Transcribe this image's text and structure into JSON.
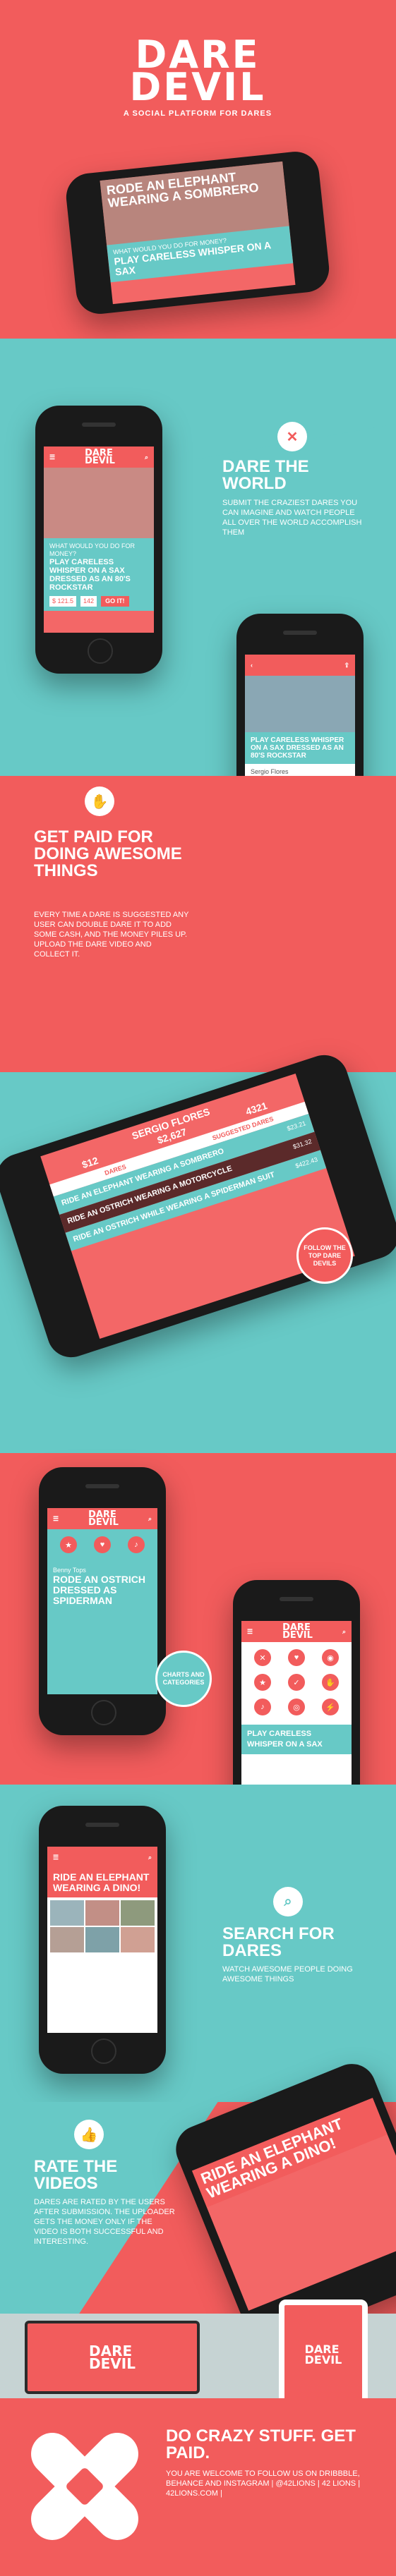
{
  "brand": {
    "logo_line1": "DARE",
    "logo_line2": "DEVIL",
    "tagline": "A SOCIAL PLATFORM FOR DARES"
  },
  "hero_phone": {
    "headline": "RODE AN ELEPHANT WEARING A SOMBRERO",
    "prompt": "WHAT WOULD YOU DO FOR MONEY?",
    "dare": "PLAY CARELESS WHISPER ON A SAX"
  },
  "feature_dare": {
    "title": "DARE THE WORLD",
    "body": "SUBMIT THE CRAZIEST DARES YOU CAN IMAGINE AND WATCH PEOPLE ALL OVER THE WORLD ACCOMPLISH THEM"
  },
  "phone_a": {
    "prompt": "WHAT WOULD YOU DO FOR MONEY?",
    "dare": "PLAY CARELESS WHISPER ON A SAX DRESSED AS AN 80'S ROCKSTAR",
    "amount": "$ 121.5",
    "count": "142",
    "go_label": "GO IT!"
  },
  "phone_b": {
    "dare": "PLAY CARELESS WHISPER ON A SAX DRESSED AS AN 80'S ROCKSTAR",
    "user": "Sergio Flores"
  },
  "feature_paid": {
    "title": "GET PAID FOR DOING AWESOME THINGS",
    "body": "EVERY TIME A DARE IS SUGGESTED ANY USER CAN DOUBLE DARE IT TO ADD SOME CASH, AND THE MONEY PILES UP. UPLOAD THE DARE VIDEO AND COLLECT IT."
  },
  "profile_phone": {
    "name": "SERGIO FLORES",
    "stat1": "$12",
    "stat2": "$2,627",
    "stat3": "4321",
    "tab1": "DARES",
    "tab2": "SUGGESTED DARES",
    "row1": "RIDE AN ELEPHANT WEARING A SOMBRERO",
    "row1_amount": "$23.21",
    "row2": "RIDE AN OSTRICH WEARING A MOTORCYCLE",
    "row2_amount": "$31.32",
    "row3": "RIDE AN OSTRICH WHILE WEARING A SPIDERMAN SUIT",
    "row3_amount": "$422.43"
  },
  "badge_follow": "FOLLOW THE TOP DARE DEVILS",
  "phone_c": {
    "user": "Benny Tops",
    "dare": "RODE AN OSTRICH DRESSED AS SPIDERMAN"
  },
  "phone_d": {
    "dare": "PLAY CARELESS WHISPER ON A SAX"
  },
  "badge_charts": "CHARTS AND CATEGORIES",
  "phone_e": {
    "dare": "RIDE AN ELEPHANT WEARING A DINO!"
  },
  "feature_search": {
    "title": "SEARCH FOR DARES",
    "body": "WATCH AWESOME PEOPLE DOING AWESOME THINGS"
  },
  "tilt_phone": {
    "dare": "RIDE AN ELEPHANT WEARING A DINO!"
  },
  "feature_rate": {
    "title": "RATE THE VIDEOS",
    "body": "DARES ARE RATED BY THE USERS AFTER SUBMISSION. THE UPLOADER GETS THE MONEY ONLY IF THE VIDEO IS BOTH SUCCESSFUL AND INTERESTING."
  },
  "closing": {
    "title": "DO CRAZY STUFF. GET PAID.",
    "body": "YOU ARE WELCOME TO FOLLOW US ON DRIBBBLE, BEHANCE AND INSTAGRAM | @42lions | 42 LIONS | 42LIONS.COM |"
  }
}
